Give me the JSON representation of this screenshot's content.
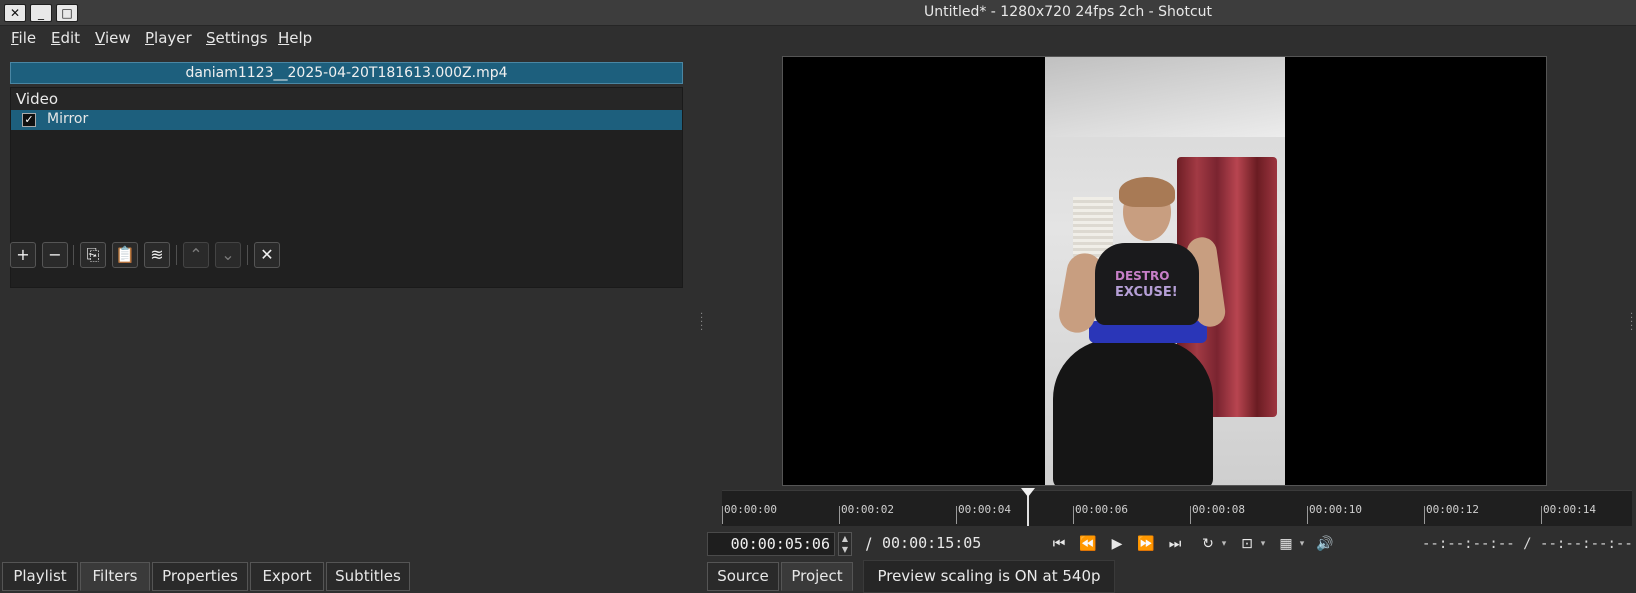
{
  "window": {
    "title": "Untitled* - 1280x720 24fps 2ch - Shotcut",
    "close_label": "✕",
    "minimize_label": "_",
    "maximize_label": "□"
  },
  "menu": [
    {
      "first": "F",
      "rest": "ile"
    },
    {
      "first": "E",
      "rest": "dit"
    },
    {
      "first": "V",
      "rest": "iew"
    },
    {
      "first": "P",
      "rest": "layer"
    },
    {
      "first": "S",
      "rest": "ettings"
    },
    {
      "first": "H",
      "rest": "elp"
    }
  ],
  "filters": {
    "clip_name": "daniam1123__2025-04-20T181613.000Z.mp4",
    "group": "Video",
    "items": [
      {
        "label": "Mirror",
        "checked": true,
        "check_glyph": "✓"
      }
    ],
    "toolbar_icons": [
      {
        "name": "add-filter",
        "glyph": "+",
        "enabled": true
      },
      {
        "name": "remove-filter",
        "glyph": "−",
        "enabled": true
      },
      {
        "name": "copy-filters",
        "glyph": "⎘",
        "enabled": true
      },
      {
        "name": "paste-filters",
        "glyph": "📋",
        "enabled": true
      },
      {
        "name": "save-preset",
        "glyph": "≋",
        "enabled": true
      },
      {
        "name": "move-up",
        "glyph": "⌃",
        "enabled": false
      },
      {
        "name": "move-down",
        "glyph": "⌄",
        "enabled": false
      },
      {
        "name": "deselect",
        "glyph": "✕",
        "enabled": true
      }
    ]
  },
  "left_tabs": [
    "Playlist",
    "Filters",
    "Properties",
    "Export",
    "Subtitles"
  ],
  "left_tab_active": "Filters",
  "video_preview": {
    "shirt_line1": "DESTRO",
    "shirt_line2": "EXCUSE!"
  },
  "ruler": {
    "labels": [
      "00:00:00",
      "00:00:02",
      "00:00:04",
      "00:00:06",
      "00:00:08",
      "00:00:10",
      "00:00:12",
      "00:00:14"
    ]
  },
  "transport": {
    "current_timecode": "00:00:05:06",
    "separator": "/",
    "total_duration": "00:00:15:05",
    "spin_up": "▲",
    "spin_down": "▼",
    "in_point": "--:--:--:--",
    "out_point": "--:--:--:--",
    "buttons": [
      {
        "name": "skip-previous",
        "glyph": "⏮"
      },
      {
        "name": "rewind",
        "glyph": "⏪"
      },
      {
        "name": "play",
        "glyph": "▶"
      },
      {
        "name": "fast-forward",
        "glyph": "⏩"
      },
      {
        "name": "skip-next",
        "glyph": "⏭"
      },
      {
        "name": "loop",
        "glyph": "↻"
      },
      {
        "name": "zoom",
        "glyph": "⊡"
      },
      {
        "name": "grid",
        "glyph": "▦"
      },
      {
        "name": "volume",
        "glyph": "🔊"
      }
    ],
    "dropdown_glyph": "▾"
  },
  "right_tabs": [
    "Source",
    "Project"
  ],
  "right_tab_active": "Project",
  "status": "Preview scaling is ON at 540p",
  "colors": {
    "selection": "#1d5f7d",
    "background": "#2f2f2f"
  }
}
